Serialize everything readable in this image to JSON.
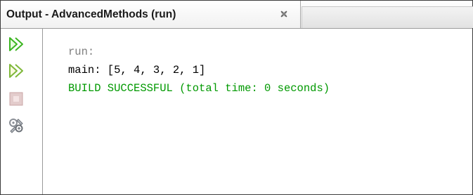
{
  "tab": {
    "title": "Output - AdvancedMethods (run)",
    "close_icon": "close-icon"
  },
  "toolbar": {
    "buttons": [
      {
        "name": "rerun",
        "icon": "double-play-icon"
      },
      {
        "name": "rerun-with-parameters",
        "icon": "double-play-outline-icon"
      },
      {
        "name": "stop",
        "icon": "stop-icon"
      },
      {
        "name": "settings",
        "icon": "tools-icon"
      }
    ]
  },
  "console": {
    "lines": [
      {
        "text": "run:",
        "color": "#7f7f7f"
      },
      {
        "text": "main: [5, 4, 3, 2, 1]",
        "color": "#000000"
      },
      {
        "text": "BUILD SUCCESSFUL (total time: 0 seconds)",
        "color": "#009900"
      }
    ]
  },
  "colors": {
    "run_green": "#3cb521",
    "stop_gray": "#c9a6a6"
  }
}
